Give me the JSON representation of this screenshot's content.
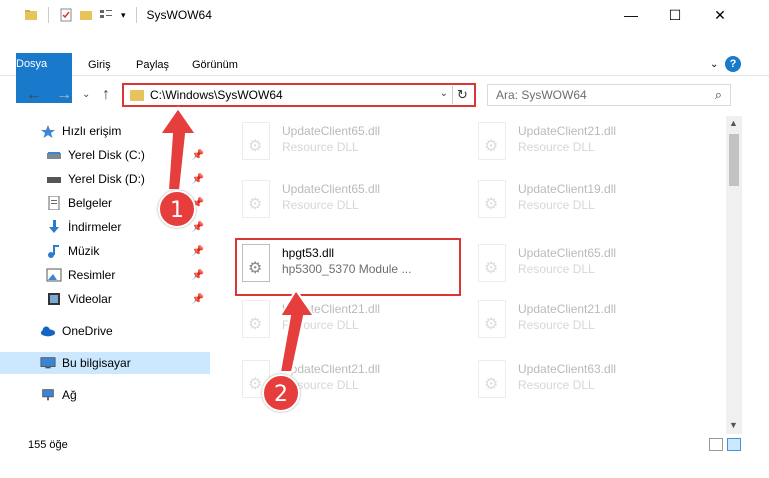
{
  "window": {
    "title": "SysWOW64",
    "controls": {
      "minimize": "—",
      "maximize": "☐",
      "close": "✕"
    }
  },
  "ribbon": {
    "tabs": [
      "Dosya",
      "Giriş",
      "Paylaş",
      "Görünüm"
    ],
    "help": "?"
  },
  "address": {
    "path": "C:\\Windows\\SysWOW64",
    "search_placeholder": "Ara: SysWOW64"
  },
  "nav": {
    "items": [
      {
        "label": "Hızlı erişim",
        "icon": "star-icon"
      },
      {
        "label": "Yerel Disk (C:)",
        "icon": "drive-icon",
        "pinned": true
      },
      {
        "label": "Yerel Disk (D:)",
        "icon": "drive-icon",
        "pinned": true
      },
      {
        "label": "Belgeler",
        "icon": "documents-icon",
        "pinned": true
      },
      {
        "label": "İndirmeler",
        "icon": "download-icon",
        "pinned": true
      },
      {
        "label": "Müzik",
        "icon": "music-icon",
        "pinned": true
      },
      {
        "label": "Resimler",
        "icon": "pictures-icon",
        "pinned": true
      },
      {
        "label": "Videolar",
        "icon": "videos-icon",
        "pinned": true
      },
      {
        "label": "OneDrive",
        "icon": "cloud-icon"
      },
      {
        "label": "Bu bilgisayar",
        "icon": "computer-icon",
        "selected": true
      },
      {
        "label": "Ağ",
        "icon": "network-icon"
      }
    ]
  },
  "files": {
    "left": [
      {
        "name": "UpdateClient65.dll",
        "type": "Resource DLL"
      },
      {
        "name": "UpdateClient65.dll",
        "type": "Resource DLL"
      },
      {
        "name": "hpgt53.dll",
        "type": "hp5300_5370 Module ..."
      },
      {
        "name": "UpdateClient21.dll",
        "type": "Resource DLL"
      },
      {
        "name": "UpdateClient21.dll",
        "type": "Resource DLL"
      }
    ],
    "right": [
      {
        "name": "UpdateClient21.dll",
        "type": "Resource DLL"
      },
      {
        "name": "UpdateClient19.dll",
        "type": "Resource DLL"
      },
      {
        "name": "UpdateClient65.dll",
        "type": "Resource DLL"
      },
      {
        "name": "UpdateClient21.dll",
        "type": "Resource DLL"
      },
      {
        "name": "UpdateClient63.dll",
        "type": "Resource DLL"
      }
    ]
  },
  "status": {
    "count": "155 öğe"
  },
  "annotations": {
    "step1": "1",
    "step2": "2"
  },
  "colors": {
    "accent": "#1979ca",
    "annotation": "#e63d3d",
    "selected": "#cce8ff"
  }
}
